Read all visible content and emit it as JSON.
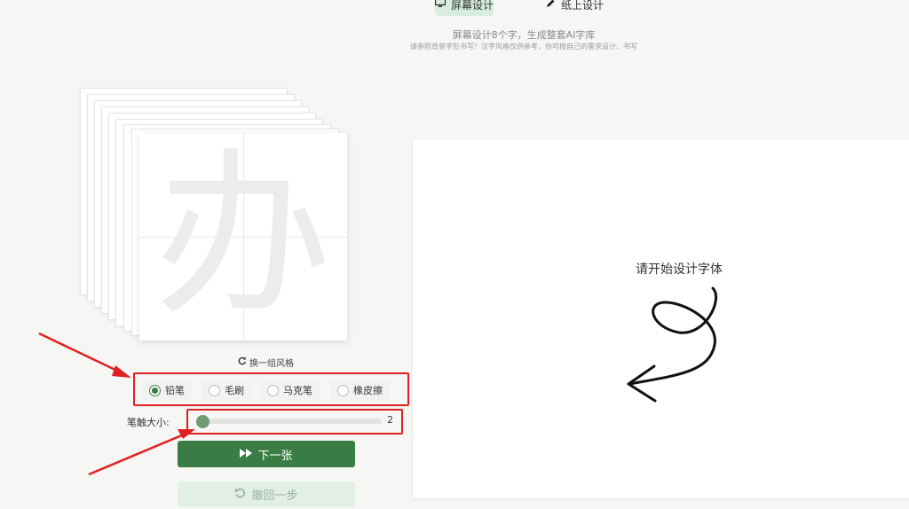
{
  "tabs": {
    "screen_label": "屏幕设计",
    "paper_label": "纸上设计"
  },
  "subtitle": {
    "line1": "屏幕设计8个字，生成整套AI字库",
    "line2": "请参照背景字形书写！汉字风格仅供参考，你可按自己的需求设计、书写"
  },
  "reference_char": "办",
  "change_style_label": "换一组风格",
  "brushes": {
    "selected": "铅笔",
    "options": [
      "铅笔",
      "毛刷",
      "马克笔",
      "橡皮擦"
    ]
  },
  "stroke_size": {
    "label": "笔触大小:",
    "value": "2",
    "level": 0.02
  },
  "buttons": {
    "next_label": "下一张",
    "undo_label": "撤回一步"
  },
  "canvas": {
    "hint": "请开始设计字体"
  },
  "colors": {
    "accent": "#3a7d44",
    "annotation": "#e02020"
  },
  "icons": {
    "screen": "monitor-icon",
    "paper": "pencil-icon",
    "refresh": "refresh-icon",
    "next": "fast-forward-icon",
    "undo": "undo-icon"
  }
}
